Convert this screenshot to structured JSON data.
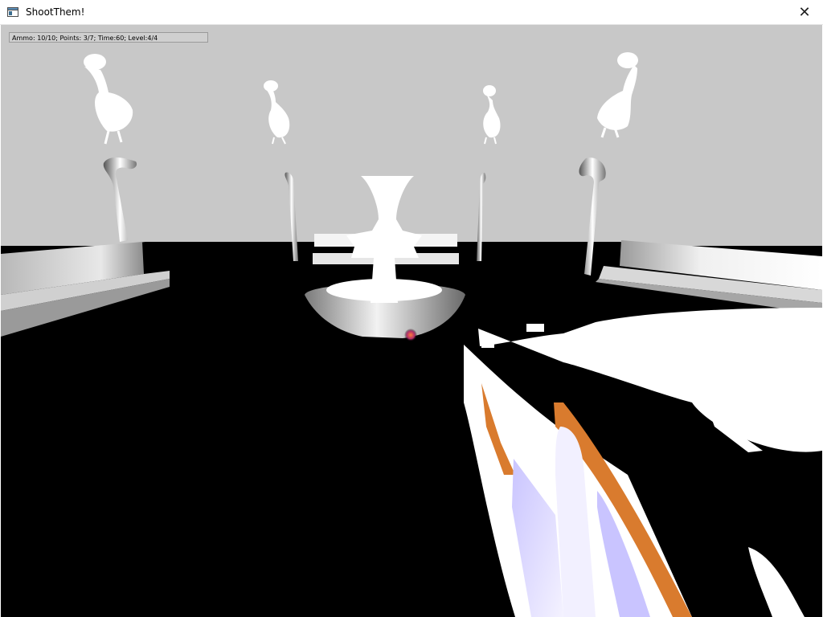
{
  "window": {
    "title": "ShootThem!",
    "close_glyph": "✕",
    "app_icon": "window-app-icon"
  },
  "hud": {
    "status_text": "Ammo: 10/10; Points: 3/7; Time:60; Level:4/4"
  },
  "scene": {
    "targets": [
      "chicken-target",
      "chicken-target",
      "chicken-target",
      "chicken-target"
    ],
    "colors": {
      "wall": "#c8c8c8",
      "floor": "#000000",
      "gun_accent": "#d97b2e",
      "gun_body": "#ffffff",
      "gun_glass": "#d8d4ff"
    }
  }
}
